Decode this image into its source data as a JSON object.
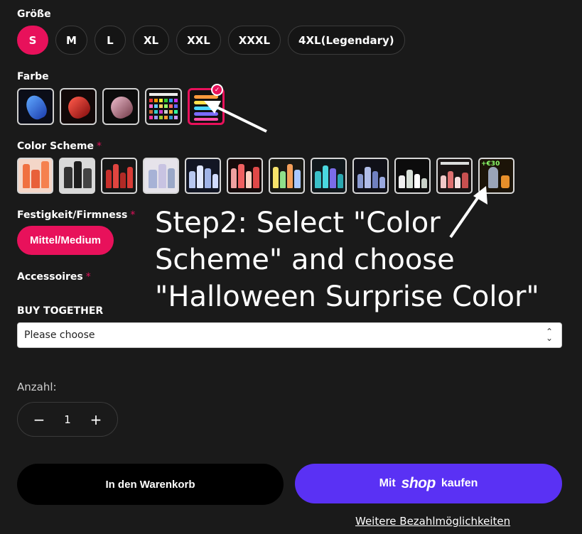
{
  "size": {
    "label": "Größe",
    "options": [
      "S",
      "M",
      "L",
      "XL",
      "XXL",
      "XXXL",
      "4XL(Legendary)"
    ],
    "selected": "S"
  },
  "color": {
    "label": "Farbe",
    "swatch_count": 5,
    "selected_index": 4
  },
  "color_scheme": {
    "label": "Color Scheme",
    "required_mark": "*",
    "swatch_count": 12,
    "badge_text": "+€30"
  },
  "firmness": {
    "label": "Festigkeit/Firmness",
    "required_mark": "*",
    "selected": "Mittel/Medium"
  },
  "accessories": {
    "label": "Accessoires",
    "required_mark": "*"
  },
  "buy_together": {
    "label": "BUY TOGETHER",
    "placeholder": "Please choose"
  },
  "annotation": {
    "text": "Step2: Select \"Color Scheme\" and choose \"Halloween Surprise Color\""
  },
  "quantity": {
    "label": "Anzahl:",
    "value": "1",
    "minus": "−",
    "plus": "+"
  },
  "actions": {
    "add_to_cart": "In den Warenkorb",
    "shop_pay_prefix": "Mit",
    "shop_pay_logo": "shop",
    "shop_pay_suffix": "kaufen",
    "more_payment": "Weitere Bezahlmöglichkeiten"
  },
  "colors": {
    "accent": "#e8115b",
    "shop_purple": "#5a31f4",
    "background": "#1a1a1a"
  }
}
